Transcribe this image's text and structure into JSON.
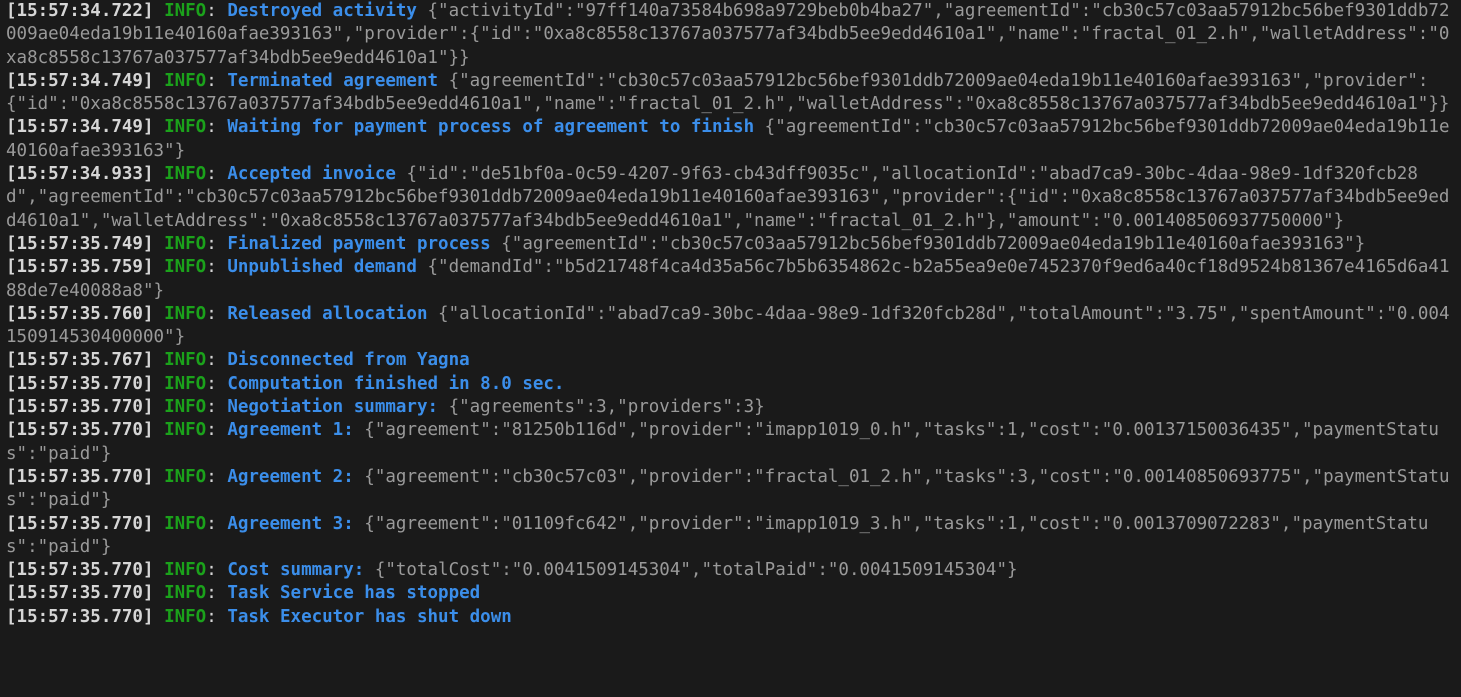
{
  "terminal": {
    "background_color": "#1a1a1a",
    "timestamp_color": "#d6d6d6",
    "level_color": "#1ba21b",
    "message_color": "#3b8eea",
    "payload_color": "#9a9a9a",
    "lines": [
      {
        "timestamp": "[15:57:34.722]",
        "level": "INFO",
        "separator": ":",
        "message": "Destroyed activity",
        "payload": "{\"activityId\":\"97ff140a73584b698a9729beb0b4ba27\",\"agreementId\":\"cb30c57c03aa57912bc56bef9301ddb72009ae04eda19b11e40160afae393163\",\"provider\":{\"id\":\"0xa8c8558c13767a037577af34bdb5ee9edd4610a1\",\"name\":\"fractal_01_2.h\",\"walletAddress\":\"0xa8c8558c13767a037577af34bdb5ee9edd4610a1\"}}"
      },
      {
        "timestamp": "[15:57:34.749]",
        "level": "INFO",
        "separator": ":",
        "message": "Terminated agreement",
        "payload": "{\"agreementId\":\"cb30c57c03aa57912bc56bef9301ddb72009ae04eda19b11e40160afae393163\",\"provider\":{\"id\":\"0xa8c8558c13767a037577af34bdb5ee9edd4610a1\",\"name\":\"fractal_01_2.h\",\"walletAddress\":\"0xa8c8558c13767a037577af34bdb5ee9edd4610a1\"}}"
      },
      {
        "timestamp": "[15:57:34.749]",
        "level": "INFO",
        "separator": ":",
        "message": "Waiting for payment process of agreement to finish",
        "payload": "{\"agreementId\":\"cb30c57c03aa57912bc56bef9301ddb72009ae04eda19b11e40160afae393163\"}"
      },
      {
        "timestamp": "[15:57:34.933]",
        "level": "INFO",
        "separator": ":",
        "message": "Accepted invoice",
        "payload": "{\"id\":\"de51bf0a-0c59-4207-9f63-cb43dff9035c\",\"allocationId\":\"abad7ca9-30bc-4daa-98e9-1df320fcb28d\",\"agreementId\":\"cb30c57c03aa57912bc56bef9301ddb72009ae04eda19b11e40160afae393163\",\"provider\":{\"id\":\"0xa8c8558c13767a037577af34bdb5ee9edd4610a1\",\"walletAddress\":\"0xa8c8558c13767a037577af34bdb5ee9edd4610a1\",\"name\":\"fractal_01_2.h\"},\"amount\":\"0.001408506937750000\"}"
      },
      {
        "timestamp": "[15:57:35.749]",
        "level": "INFO",
        "separator": ":",
        "message": "Finalized payment process",
        "payload": "{\"agreementId\":\"cb30c57c03aa57912bc56bef9301ddb72009ae04eda19b11e40160afae393163\"}"
      },
      {
        "timestamp": "[15:57:35.759]",
        "level": "INFO",
        "separator": ":",
        "message": "Unpublished demand",
        "payload": "{\"demandId\":\"b5d21748f4ca4d35a56c7b5b6354862c-b2a55ea9e0e7452370f9ed6a40cf18d9524b81367e4165d6a4188de7e40088a8\"}"
      },
      {
        "timestamp": "[15:57:35.760]",
        "level": "INFO",
        "separator": ":",
        "message": "Released allocation",
        "payload": "{\"allocationId\":\"abad7ca9-30bc-4daa-98e9-1df320fcb28d\",\"totalAmount\":\"3.75\",\"spentAmount\":\"0.004150914530400000\"}"
      },
      {
        "timestamp": "[15:57:35.767]",
        "level": "INFO",
        "separator": ":",
        "message": "Disconnected from Yagna",
        "payload": ""
      },
      {
        "timestamp": "[15:57:35.770]",
        "level": "INFO",
        "separator": ":",
        "message": "Computation finished in 8.0 sec.",
        "payload": ""
      },
      {
        "timestamp": "[15:57:35.770]",
        "level": "INFO",
        "separator": ":",
        "message": "Negotiation summary:",
        "payload": "{\"agreements\":3,\"providers\":3}"
      },
      {
        "timestamp": "[15:57:35.770]",
        "level": "INFO",
        "separator": ":",
        "message": "Agreement 1:",
        "payload": "{\"agreement\":\"81250b116d\",\"provider\":\"imapp1019_0.h\",\"tasks\":1,\"cost\":\"0.00137150036435\",\"paymentStatus\":\"paid\"}"
      },
      {
        "timestamp": "[15:57:35.770]",
        "level": "INFO",
        "separator": ":",
        "message": "Agreement 2:",
        "payload": "{\"agreement\":\"cb30c57c03\",\"provider\":\"fractal_01_2.h\",\"tasks\":3,\"cost\":\"0.00140850693775\",\"paymentStatus\":\"paid\"}"
      },
      {
        "timestamp": "[15:57:35.770]",
        "level": "INFO",
        "separator": ":",
        "message": "Agreement 3:",
        "payload": "{\"agreement\":\"01109fc642\",\"provider\":\"imapp1019_3.h\",\"tasks\":1,\"cost\":\"0.0013709072283\",\"paymentStatus\":\"paid\"}"
      },
      {
        "timestamp": "[15:57:35.770]",
        "level": "INFO",
        "separator": ":",
        "message": "Cost summary:",
        "payload": "{\"totalCost\":\"0.0041509145304\",\"totalPaid\":\"0.0041509145304\"}"
      },
      {
        "timestamp": "[15:57:35.770]",
        "level": "INFO",
        "separator": ":",
        "message": "Task Service has stopped",
        "payload": ""
      },
      {
        "timestamp": "[15:57:35.770]",
        "level": "INFO",
        "separator": ":",
        "message": "Task Executor has shut down",
        "payload": ""
      }
    ]
  }
}
